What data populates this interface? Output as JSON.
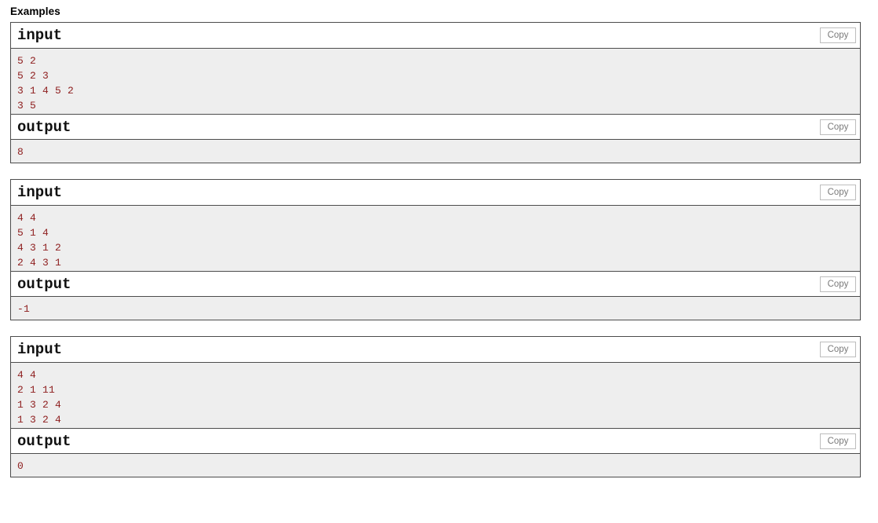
{
  "page": {
    "section_title": "Examples",
    "copy_label": "Copy",
    "input_label": "input",
    "output_label": "output",
    "colors": {
      "code_text": "#8f2020",
      "code_background": "#eeeeee",
      "block_border": "#4c4c4c",
      "copy_button_border": "#bdbdbd",
      "copy_button_text": "#7a7a7a",
      "header_background": "#ffffff",
      "page_background": "#ffffff",
      "title_text": "#000000"
    }
  },
  "examples": [
    {
      "input": "5 2\n5 2 3\n3 1 4 5 2\n3 5",
      "output": "8"
    },
    {
      "input": "4 4\n5 1 4\n4 3 1 2\n2 4 3 1",
      "output": "-1"
    },
    {
      "input": "4 4\n2 1 11\n1 3 2 4\n1 3 2 4",
      "output": "0"
    }
  ]
}
